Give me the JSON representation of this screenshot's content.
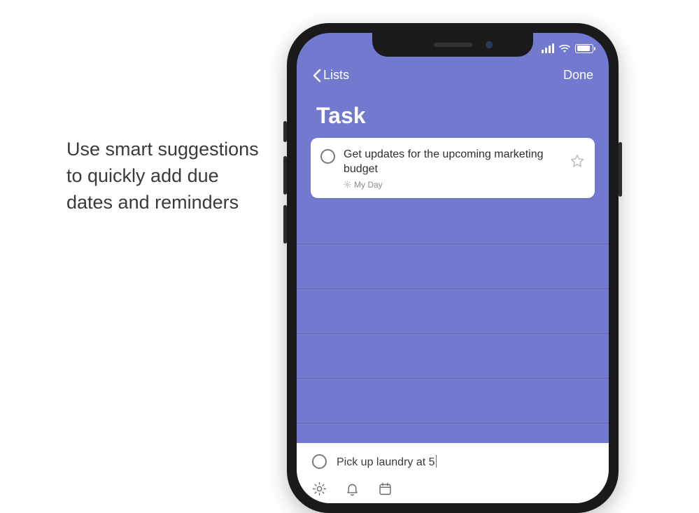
{
  "caption": "Use smart suggestions to quickly add due dates and reminders",
  "nav": {
    "back_label": "Lists",
    "done_label": "Done"
  },
  "page_title": "Task",
  "task": {
    "title": "Get updates for the upcoming marketing budget",
    "sublabel": "My Day"
  },
  "input": {
    "text": "Pick up laundry at 5"
  },
  "icons": {
    "sun": "sun-icon",
    "bell": "bell-icon",
    "calendar": "calendar-icon",
    "star": "star-icon",
    "chevron": "chevron-left-icon",
    "wifi": "wifi-icon",
    "signal": "signal-icon",
    "battery": "battery-icon"
  },
  "colors": {
    "accent": "#7279ce",
    "text": "#2e2e2e"
  }
}
